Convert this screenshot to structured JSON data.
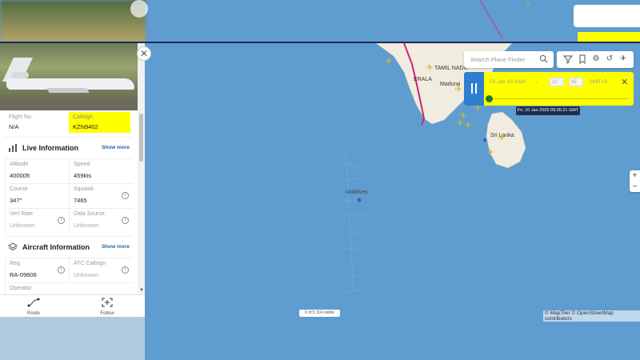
{
  "panel": {
    "flight_no_label": "Flight No.",
    "flight_no_value": "N/A",
    "callsign_label": "Callsign",
    "callsign_value": "KZN9402",
    "live_title": "Live Information",
    "show_more": "Show more",
    "altitude_label": "Altitude",
    "altitude_value": "40000ft",
    "speed_label": "Speed",
    "speed_value": "459kts",
    "course_label": "Course",
    "course_value": "347°",
    "squawk_label": "Squawk",
    "squawk_value": "7465",
    "vert_rate_label": "Vert Rate",
    "vert_rate_value": "Unknown",
    "data_source_label": "Data Source",
    "data_source_value": "Unknown",
    "aircraft_title": "Aircraft Information",
    "reg_label": "Reg",
    "reg_value": "RA-09606",
    "atc_callsign_label": "ATC Callsign",
    "atc_callsign_value": "Unknown",
    "operator_label": "Operator"
  },
  "nav": {
    "route_label": "Route",
    "follow_label": "Follow"
  },
  "search": {
    "placeholder": "Search Plane Finder"
  },
  "playback": {
    "date": "Fri Jan 10 2020",
    "hour": "12",
    "minute": "05",
    "tz": "GMT+3",
    "tooltip": "Fri, 10 Jan 2020 09:05:21 GMT",
    "position": 0.0
  },
  "map": {
    "labels": {
      "tamil_nadu": "TAMIL NADU",
      "kerala": "ERALA",
      "madurai": "Madurai",
      "sri_lanka": "Sri Lanka",
      "maldives": "Maldives"
    },
    "visible_count": "0 of 5 114 visible",
    "attribution": "© MapTiler © OpenStreetMap contributors"
  },
  "colors": {
    "accent_blue": "#2f7fd0",
    "highlight": "#ffff00",
    "route_magenta": "#d0207a",
    "sea": "#5f9dd1",
    "land": "#f0ecdf"
  },
  "icons": {
    "close": "close-icon",
    "live": "live-icon",
    "aircraft": "layers-icon",
    "search": "search-icon",
    "filter": "filter-icon",
    "bookmark": "bookmark-icon",
    "settings": "gear-icon",
    "history": "history-icon",
    "airplane": "airplane-icon",
    "pause": "pause-icon",
    "route": "route-icon",
    "follow": "follow-icon"
  }
}
